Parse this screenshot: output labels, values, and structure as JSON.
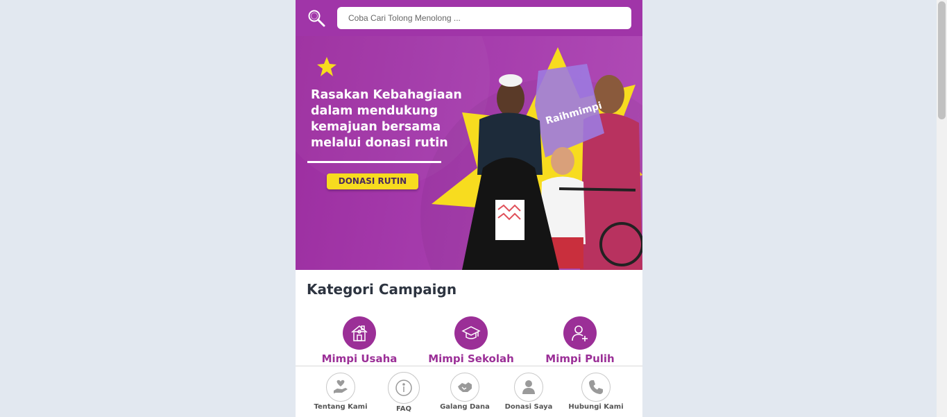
{
  "search": {
    "placeholder": "Coba Cari Tolong Menolong ..."
  },
  "banner": {
    "headline_lines": [
      "Rasakan Kebahagiaan",
      "dalam mendukung",
      "kemajuan bersama",
      "melalui donasi rutin"
    ],
    "cta_label": "DONASI RUTIN",
    "bag_brand": "Raihmimpi"
  },
  "categories": {
    "title": "Kategori Campaign",
    "items": [
      {
        "label": "Mimpi Usaha",
        "icon": "house-icon"
      },
      {
        "label": "Mimpi Sekolah",
        "icon": "graduation-cap-icon"
      },
      {
        "label": "Mimpi Pulih",
        "icon": "add-user-icon"
      }
    ]
  },
  "bottom_nav": {
    "items": [
      {
        "label": "Tentang Kami",
        "icon": "heart-hand-icon"
      },
      {
        "label": "FAQ",
        "icon": "info-icon"
      },
      {
        "label": "Galang Dana",
        "icon": "handshake-icon"
      },
      {
        "label": "Donasi Saya",
        "icon": "user-icon"
      },
      {
        "label": "Hubungi Kami",
        "icon": "phone-icon"
      }
    ]
  },
  "colors": {
    "brand_purple": "#a035a8",
    "category_purple": "#9b2f97",
    "cta_yellow": "#f7dc1f",
    "page_background": "#e2e8f0"
  }
}
